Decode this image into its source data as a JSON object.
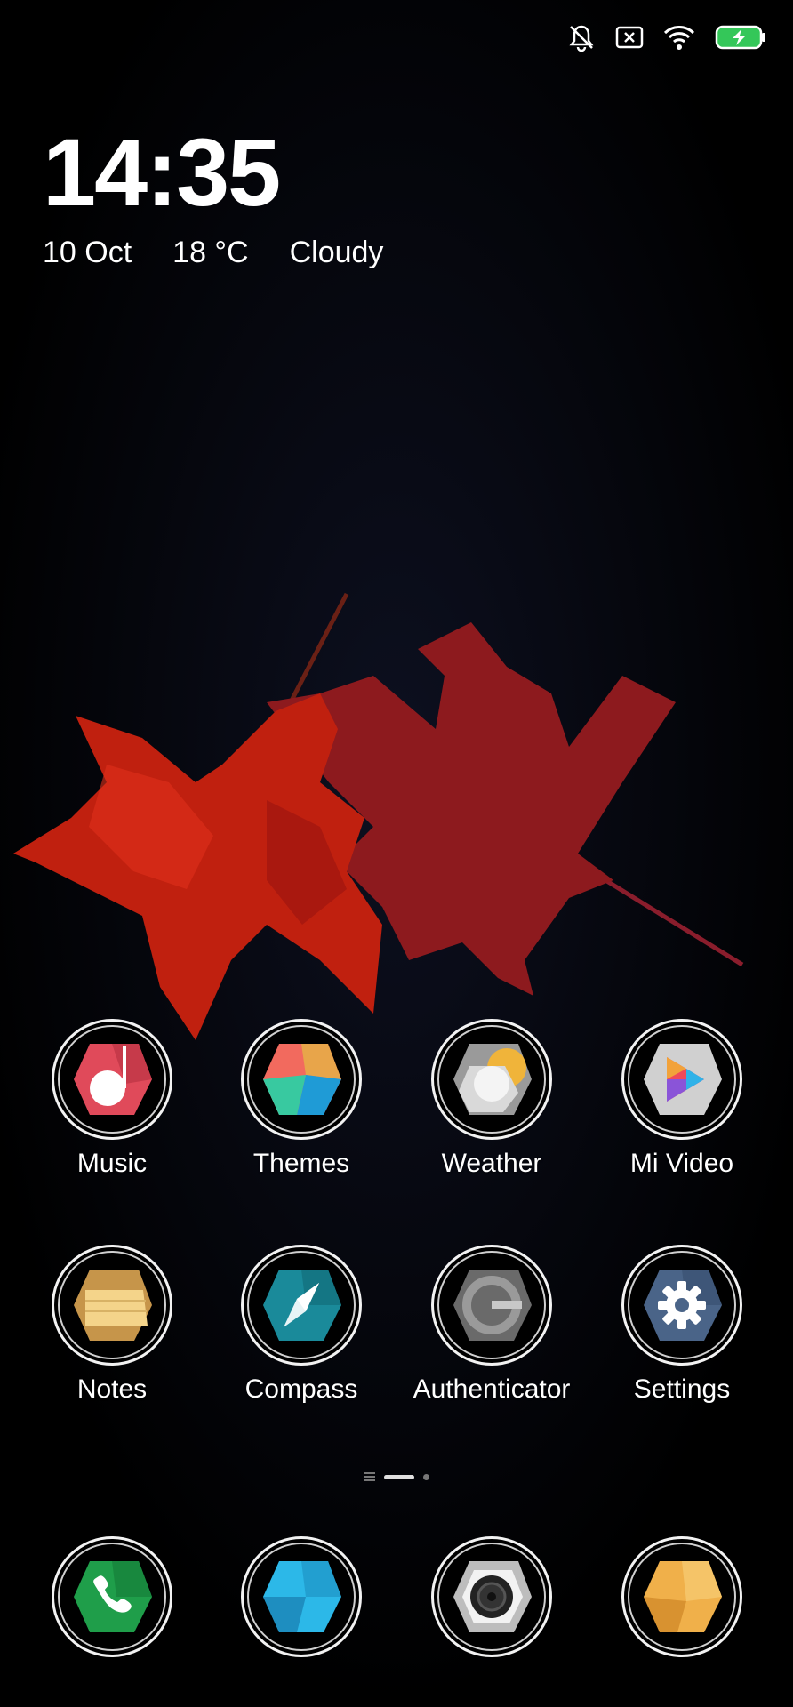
{
  "status_bar": {
    "icons": [
      "notifications-off-icon",
      "no-sim-icon",
      "wifi-icon",
      "battery-charging-icon"
    ]
  },
  "clock_widget": {
    "time": "14:35",
    "date": "10 Oct",
    "temperature": "18 °C",
    "condition": "Cloudy"
  },
  "home_apps": [
    {
      "label": "Music",
      "icon": "music-icon"
    },
    {
      "label": "Themes",
      "icon": "themes-icon"
    },
    {
      "label": "Weather",
      "icon": "weather-icon"
    },
    {
      "label": "Mi Video",
      "icon": "mi-video-icon"
    },
    {
      "label": "Notes",
      "icon": "notes-icon"
    },
    {
      "label": "Compass",
      "icon": "compass-icon"
    },
    {
      "label": "Authenticator",
      "icon": "authenticator-icon"
    },
    {
      "label": "Settings",
      "icon": "settings-icon"
    }
  ],
  "dock": [
    {
      "icon": "phone-icon"
    },
    {
      "icon": "messaging-icon"
    },
    {
      "icon": "camera-icon"
    },
    {
      "icon": "gallery-icon"
    }
  ],
  "page_indicator": {
    "total_pages": 2,
    "current_page": 1
  },
  "colors": {
    "accent_battery": "#34c759"
  }
}
